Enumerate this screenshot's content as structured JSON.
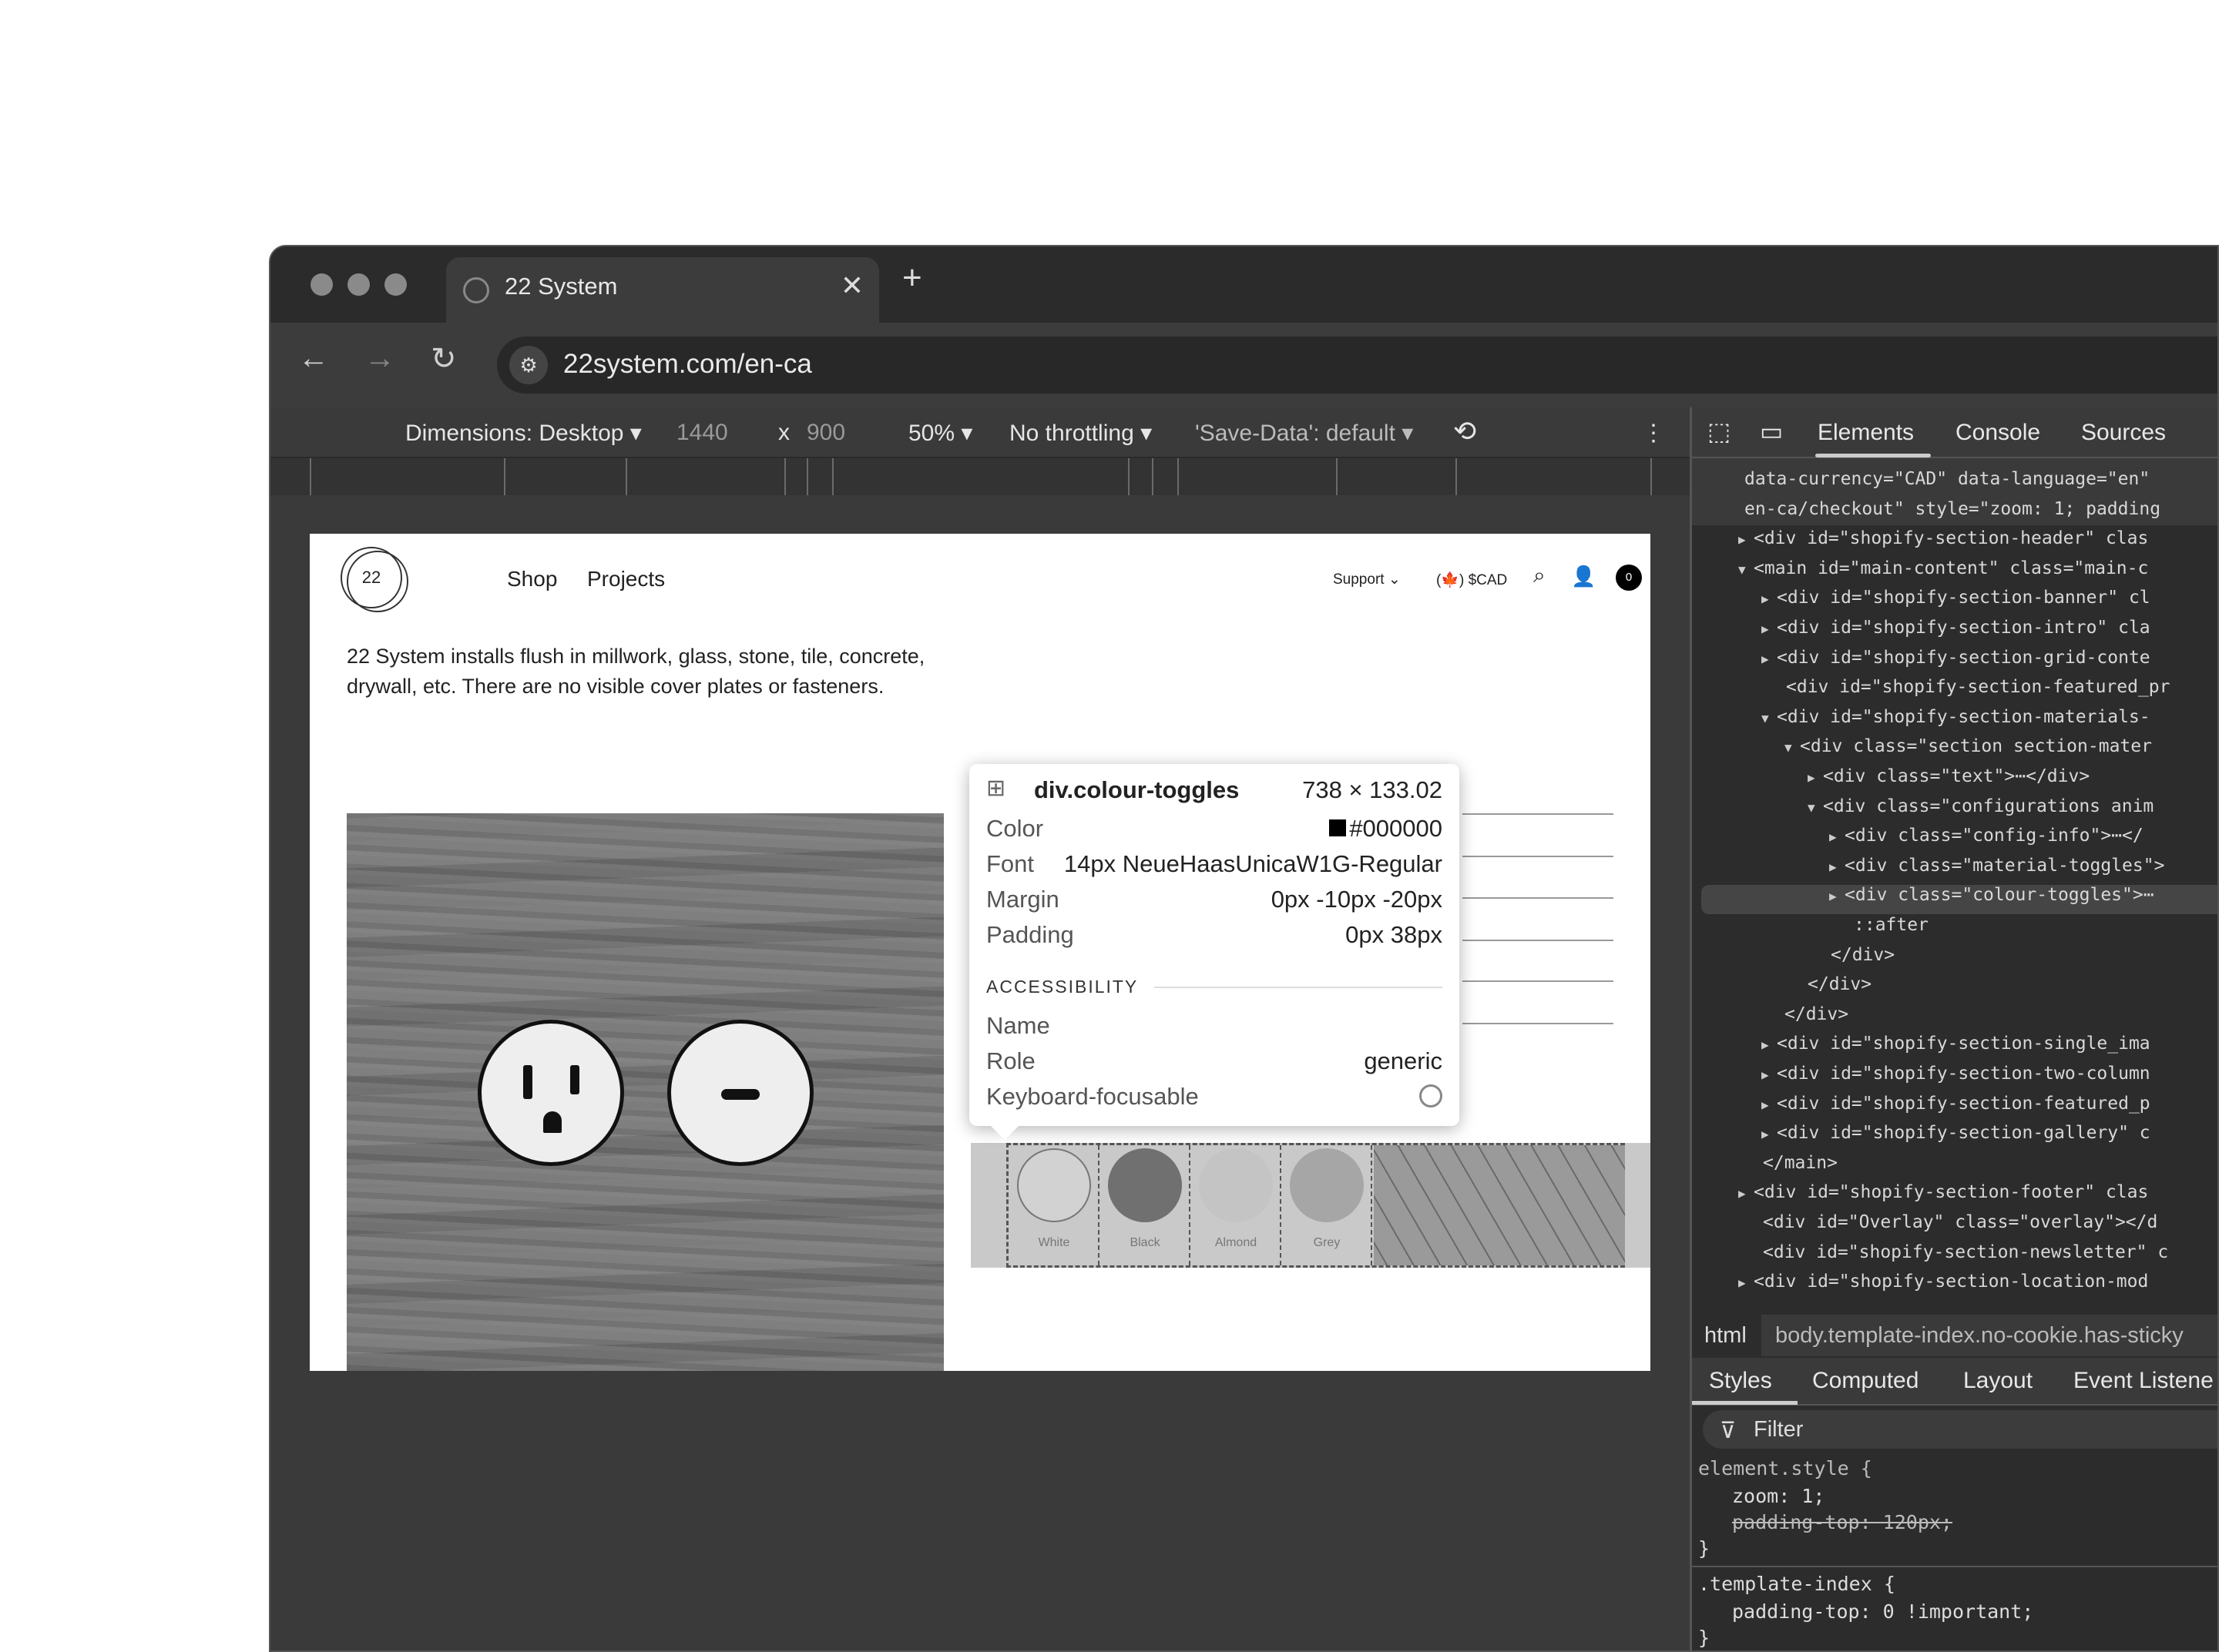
{
  "browser": {
    "tab_title": "22 System",
    "tab_close": "✕",
    "new_tab": "+",
    "url": "22system.com/en-ca",
    "nav": {
      "back": "←",
      "forward": "→",
      "reload": "↻",
      "site_info": "⚙"
    }
  },
  "device_toolbar": {
    "dimensions": "Dimensions: Desktop ▾",
    "width": "1440",
    "times": "x",
    "height": "900",
    "zoom": "50% ▾",
    "throttling": "No throttling ▾",
    "save_data": "'Save-Data': default ▾",
    "more": "⋮"
  },
  "page": {
    "logo": "22",
    "nav": [
      "Shop",
      "Projects"
    ],
    "support": "Support ⌄",
    "currency": "(🍁) $CAD",
    "cart_count": "0",
    "intro": "22 System installs flush in millwork, glass, stone, tile, concrete, drywall, etc. There are no visible cover plates or fasteners.",
    "colours": [
      "White",
      "Black",
      "Almond",
      "Grey"
    ],
    "colour_hex": [
      "#d2d2d2",
      "#707070",
      "#c4c4c4",
      "#a6a6a6"
    ]
  },
  "tooltip": {
    "selector": "div.colour-toggles",
    "size": "738 × 133.02",
    "rows": [
      {
        "label": "Color",
        "value": "#000000"
      },
      {
        "label": "Font",
        "value": "14px NeueHaasUnicaW1G-Regular"
      },
      {
        "label": "Margin",
        "value": "0px -10px -20px"
      },
      {
        "label": "Padding",
        "value": "0px 38px"
      }
    ],
    "accessibility_heading": "ACCESSIBILITY",
    "a11y": [
      {
        "label": "Name",
        "value": ""
      },
      {
        "label": "Role",
        "value": "generic"
      },
      {
        "label": "Keyboard-focusable",
        "value": "⃠"
      }
    ]
  },
  "devtools": {
    "tabs": [
      "Elements",
      "Console",
      "Sources"
    ],
    "tree": [
      "data-currency=\"CAD\" data-language=\"en\"",
      "en-ca/checkout\" style=\"zoom: 1; padding",
      "<div id=\"shopify-section-header\" clas",
      "<main id=\"main-content\" class=\"main-c",
      "<div id=\"shopify-section-banner\" cl",
      "<div id=\"shopify-section-intro\" cla",
      "<div id=\"shopify-section-grid-conte",
      "<div id=\"shopify-section-featured_pr",
      "<div id=\"shopify-section-materials-",
      "<div class=\"section section-mater",
      "<div class=\"text\">⋯</div>",
      "<div class=\"configurations anim",
      "<div class=\"config-info\">⋯</",
      "<div class=\"material-toggles\">",
      "<div class=\"colour-toggles\">⋯",
      "::after",
      "</div>",
      "</div>",
      "</div>",
      "<div id=\"shopify-section-single_ima",
      "<div id=\"shopify-section-two-column",
      "<div id=\"shopify-section-featured_p",
      "<div id=\"shopify-section-gallery\" c",
      "</main>",
      "<div id=\"shopify-section-footer\" clas",
      "<div id=\"Overlay\" class=\"overlay\"></d",
      "<div id=\"shopify-section-newsletter\" c",
      "<div id=\"shopify-section-location-mod"
    ],
    "breadcrumb": [
      "html",
      "body.template-index.no-cookie.has-sticky"
    ],
    "style_tabs": [
      "Styles",
      "Computed",
      "Layout",
      "Event Listene"
    ],
    "filter_placeholder": "Filter",
    "styles": [
      "element.style {",
      "zoom: 1;",
      "padding-top: 120px;",
      "}",
      ".template-index {",
      "padding-top: 0 !important;",
      "}"
    ]
  }
}
